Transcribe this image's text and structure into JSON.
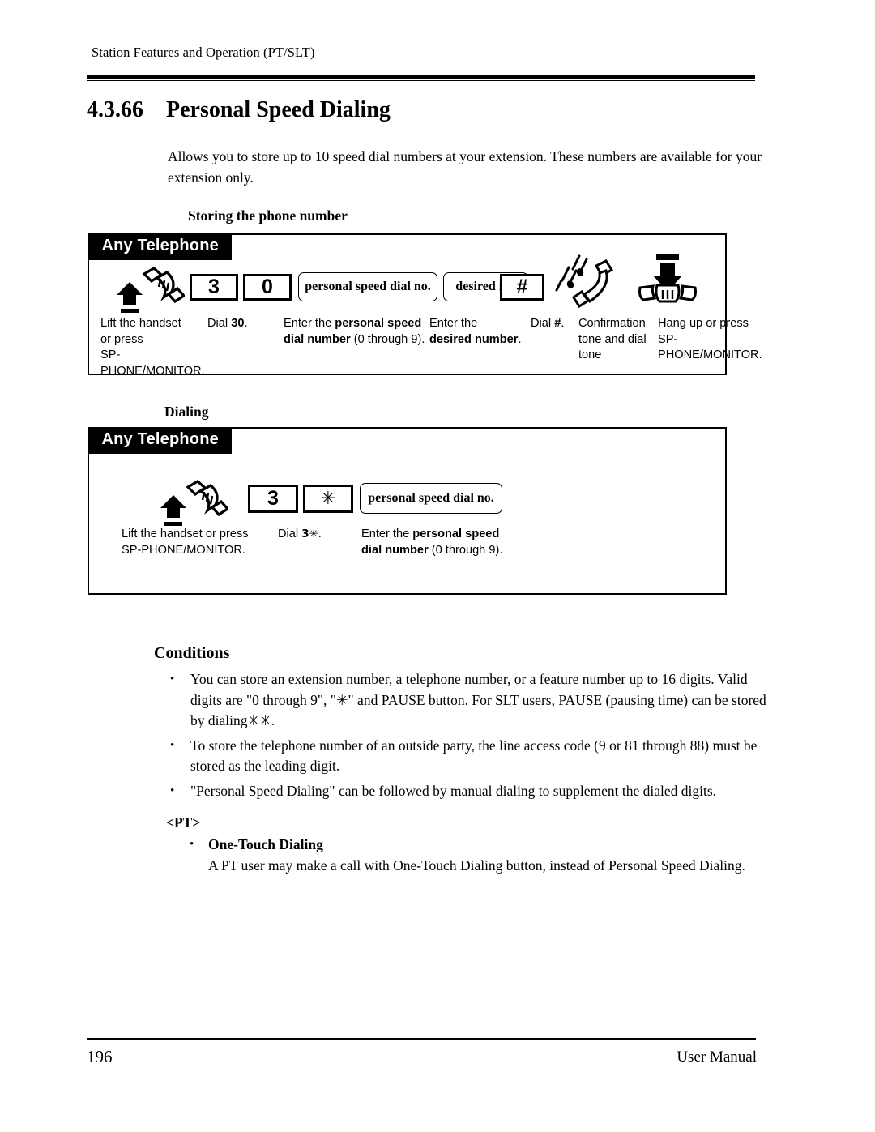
{
  "header": {
    "running_head": "Station Features and Operation (PT/SLT)"
  },
  "title": {
    "number": "4.3.66",
    "text": "Personal Speed Dialing"
  },
  "intro": "Allows you to store up to 10 speed dial numbers at your extension. These numbers are available for your extension only.",
  "sections": {
    "storing": {
      "heading": "Storing the phone number",
      "banner": "Any Telephone",
      "steps": [
        {
          "icon": "lift-handset-icon",
          "keys": [],
          "caption_lines": [
            "Lift the handset",
            "or press",
            "SP-PHONE/MONITOR."
          ]
        },
        {
          "icon": "",
          "keys": [
            "3",
            "0"
          ],
          "caption_lines": [
            "Dial 30."
          ]
        },
        {
          "icon": "",
          "variable_key": "personal speed dial no.",
          "caption_lines": [
            "Enter the personal speed",
            "dial number (0 through 9)."
          ]
        },
        {
          "icon": "",
          "variable_key": "desired no.",
          "caption_lines": [
            "Enter the",
            "desired number."
          ]
        },
        {
          "icon": "",
          "keys": [
            "#"
          ],
          "caption_lines": [
            "Dial #."
          ]
        },
        {
          "icon": "ringing-handset-icon",
          "keys": [],
          "caption_lines": [
            "Confirmation",
            "tone and dial",
            "tone"
          ]
        },
        {
          "icon": "hang-up-icon",
          "keys": [],
          "caption_lines": [
            "Hang up or press",
            "SP-PHONE/MONITOR."
          ]
        }
      ]
    },
    "dialing": {
      "heading": "Dialing",
      "banner": "Any Telephone",
      "steps": [
        {
          "icon": "lift-handset-icon",
          "keys": [],
          "caption_lines": [
            "Lift the handset or press",
            "SP-PHONE/MONITOR."
          ]
        },
        {
          "icon": "",
          "keys": [
            "3",
            "✳"
          ],
          "caption_lines": [
            "Dial 3✳."
          ]
        },
        {
          "icon": "",
          "variable_key": "personal speed dial no.",
          "caption_lines": [
            "Enter the personal speed",
            "dial number (0 through 9)."
          ]
        }
      ]
    }
  },
  "conditions": {
    "heading": "Conditions",
    "items": [
      "You can store an extension number, a telephone number, or a feature number up to 16 digits. Valid digits are \"0 through 9\", \"✳\" and PAUSE button. For SLT users, PAUSE (pausing time) can be stored by dialing✳✳.",
      "To store the telephone number of an outside party, the line access code (9 or 81 through 88) must be stored as the leading digit.",
      "\"Personal Speed Dialing\" can be followed by manual dialing to supplement the dialed digits."
    ],
    "pt_label": "<PT>",
    "pt_item": {
      "title": "One-Touch Dialing",
      "body": "A PT user may make a call with One-Touch Dialing button, instead of Personal Speed Dialing."
    }
  },
  "footer": {
    "page_number": "196",
    "doc_label": "User Manual"
  },
  "key_labels": {
    "store_key_3": "3",
    "store_key_0": "0",
    "store_key_hash": "#",
    "dial_key_3": "3",
    "dial_key_star": "✳",
    "var_personal_store": "personal speed dial no.",
    "var_desired": "desired no.",
    "var_personal_dial": "personal speed dial no."
  },
  "captions": {
    "s1_l1": "Lift the handset",
    "s1_l2": "or press",
    "s1_l3": "SP-PHONE/MONITOR.",
    "s2_dial": "Dial ",
    "s2_bold": "30",
    "s2_dot": ".",
    "s3_l1a": "Enter the ",
    "s3_l1b": "personal speed",
    "s3_l2b": "dial number",
    "s3_l2a": " (0 through 9).",
    "s4_l1": "Enter the",
    "s4_l2b": "desired number",
    "s4_l2a": ".",
    "s5_a": "Dial ",
    "s5_b": "#",
    "s5_c": ".",
    "s6_l1": "Confirmation",
    "s6_l2": "tone and dial",
    "s6_l3": "tone",
    "s7_l1": "Hang up or press",
    "s7_l2": "SP-PHONE/MONITOR.",
    "d1_l1": "Lift the handset or press",
    "d1_l2": "SP-PHONE/MONITOR.",
    "d2_a": "Dial ",
    "d2_b": "3✳",
    "d2_c": ".",
    "d3_l1a": "Enter the ",
    "d3_l1b": "personal speed",
    "d3_l2b": "dial number",
    "d3_l2a": " (0 through 9)."
  }
}
